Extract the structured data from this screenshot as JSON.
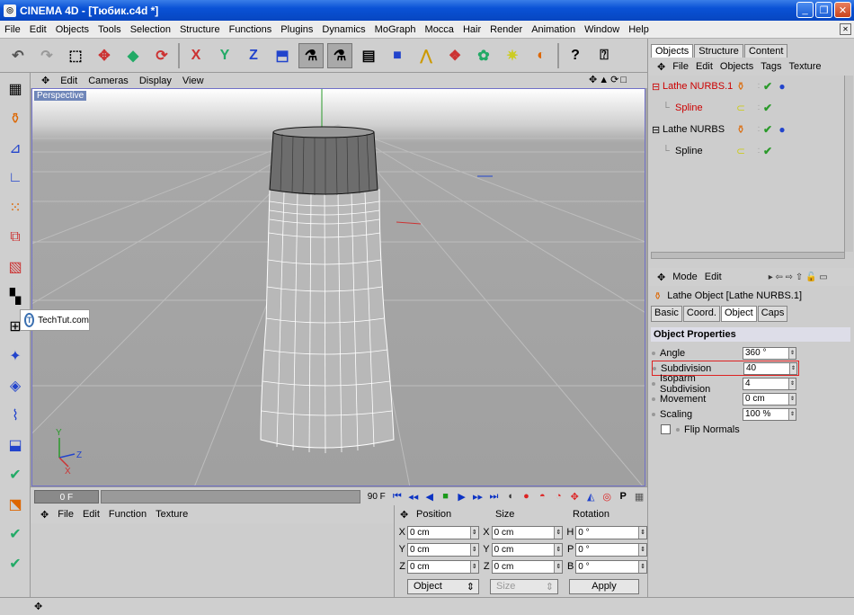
{
  "window": {
    "title": "CINEMA 4D - [Тюбик.c4d *]",
    "icon": "cinema4d-logo-icon"
  },
  "menubar": [
    "File",
    "Edit",
    "Objects",
    "Tools",
    "Selection",
    "Structure",
    "Functions",
    "Plugins",
    "Dynamics",
    "MoGraph",
    "Mocca",
    "Hair",
    "Render",
    "Animation",
    "Window",
    "Help"
  ],
  "viewport": {
    "menu": [
      "Edit",
      "Cameras",
      "Display",
      "View"
    ],
    "label": "Perspective",
    "axes": {
      "y": "Y",
      "z": "Z",
      "x": "X"
    }
  },
  "watermark": {
    "text": "TechTut.com",
    "logo": "T"
  },
  "timeline": {
    "current_frame": "0 F",
    "end_frame": "90 F"
  },
  "material_manager": {
    "menu": [
      "File",
      "Edit",
      "Function",
      "Texture"
    ]
  },
  "coordinates": {
    "headers": [
      "Position",
      "Size",
      "Rotation"
    ],
    "rows": [
      {
        "a": "X",
        "pos": "0 cm",
        "b": "X",
        "size": "0 cm",
        "c": "H",
        "rot": "0 °"
      },
      {
        "a": "Y",
        "pos": "0 cm",
        "b": "Y",
        "size": "0 cm",
        "c": "P",
        "rot": "0 °"
      },
      {
        "a": "Z",
        "pos": "0 cm",
        "b": "Z",
        "size": "0 cm",
        "c": "B",
        "rot": "0 °"
      }
    ],
    "mode_select": "Object",
    "size_select": "Size",
    "apply_label": "Apply"
  },
  "object_manager": {
    "tabs": [
      "Objects",
      "Structure",
      "Content"
    ],
    "active_tab": "Objects",
    "menu": [
      "File",
      "Edit",
      "Objects",
      "Tags",
      "Texture"
    ],
    "items": [
      {
        "name": "Lathe NURBS.1",
        "color": "#cc0000",
        "level": 0
      },
      {
        "name": "Spline",
        "color": "#cc0000",
        "level": 1
      },
      {
        "name": "Lathe NURBS",
        "color": "#000000",
        "level": 0
      },
      {
        "name": "Spline",
        "color": "#000000",
        "level": 1
      }
    ]
  },
  "attributes": {
    "menu": [
      "Mode",
      "Edit"
    ],
    "title": "Lathe Object [Lathe NURBS.1]",
    "tabs": [
      "Basic",
      "Coord.",
      "Object",
      "Caps"
    ],
    "active_tab": "Object",
    "section": "Object Properties",
    "props": [
      {
        "label": "Angle",
        "value": "360 °"
      },
      {
        "label": "Subdivision",
        "value": "40",
        "highlight": true
      },
      {
        "label": "Isoparm Subdivision",
        "value": "4"
      },
      {
        "label": "Movement",
        "value": "0 cm"
      },
      {
        "label": "Scaling",
        "value": "100 %"
      }
    ],
    "flip_normals": "Flip Normals"
  },
  "colors": {
    "title_blue": "#0a52d6",
    "selected_red": "#cc0000",
    "viewport_frame": "#7070c8"
  }
}
